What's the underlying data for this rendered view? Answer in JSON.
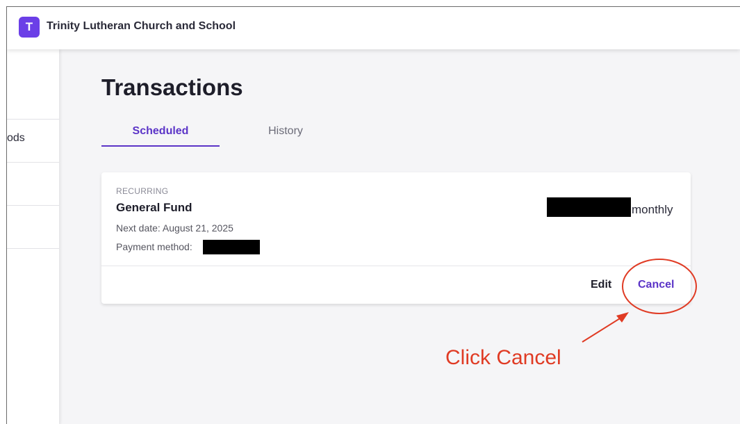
{
  "header": {
    "logo_letter": "T",
    "org_name": "Trinity Lutheran Church and School"
  },
  "sidebar": {
    "items": [
      {
        "label": "ods"
      }
    ]
  },
  "page": {
    "title": "Transactions"
  },
  "tabs": [
    {
      "label": "Scheduled",
      "active": true
    },
    {
      "label": "History",
      "active": false
    }
  ],
  "transaction": {
    "type_label": "RECURRING",
    "fund": "General Fund",
    "next_date": "Next date: August 21, 2025",
    "payment_method_label": "Payment method:",
    "frequency": "monthly",
    "edit_label": "Edit",
    "cancel_label": "Cancel"
  },
  "annotation": {
    "text": "Click Cancel",
    "color": "#e03b24"
  },
  "colors": {
    "accent": "#5b34c7",
    "logo": "#6b3fe7",
    "background": "#f5f5f7"
  }
}
